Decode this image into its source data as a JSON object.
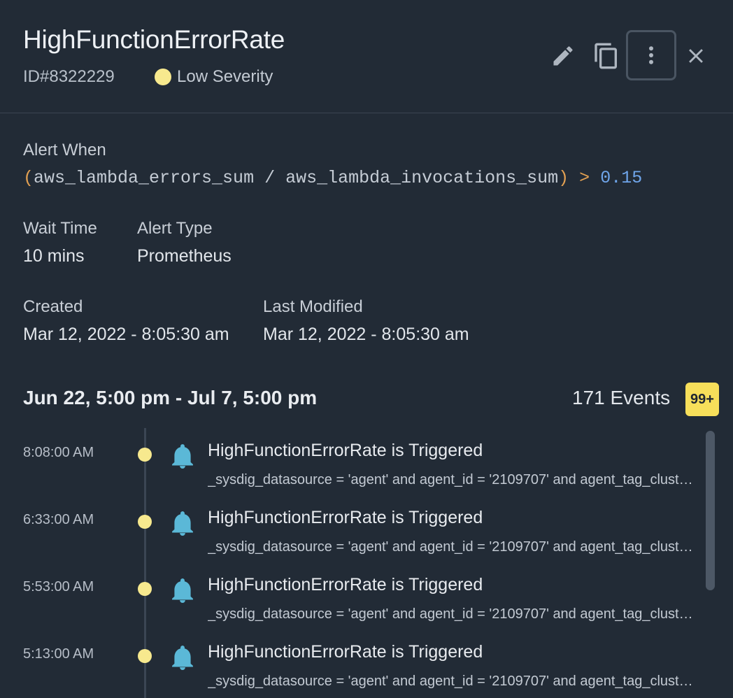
{
  "header": {
    "title": "HighFunctionErrorRate",
    "id_text": "ID#8322229",
    "severity": "Low Severity"
  },
  "icons": {
    "edit": "pencil-icon",
    "copy": "copy-icon",
    "more": "more-vertical-icon",
    "close": "close-icon",
    "event": "bell-icon"
  },
  "colors": {
    "background": "#222b36",
    "severity_low": "#f7e98e",
    "badge": "#f7df5a",
    "bell": "#5bb8d7",
    "operator": "#e2a052",
    "threshold": "#6fa5ea"
  },
  "alert": {
    "when_label": "Alert When",
    "query": {
      "open_paren": "(",
      "expr": "aws_lambda_errors_sum / aws_lambda_invocations_sum",
      "close_paren": ")",
      "operator": ">",
      "threshold": "0.15"
    },
    "wait_time_label": "Wait Time",
    "wait_time": "10 mins",
    "alert_type_label": "Alert Type",
    "alert_type": "Prometheus",
    "created_label": "Created",
    "created": "Mar 12, 2022 - 8:05:30 am",
    "modified_label": "Last Modified",
    "modified": "Mar 12, 2022 - 8:05:30 am"
  },
  "events": {
    "range": "Jun 22, 5:00 pm - Jul 7, 5:00 pm",
    "count": "171 Events",
    "badge": "99+",
    "items": [
      {
        "time": "8:08:00 AM",
        "title": "HighFunctionErrorRate is Triggered",
        "desc": "_sysdig_datasource = 'agent' and agent_id = '2109707' and agent_tag_cluster = 'prod'"
      },
      {
        "time": "6:33:00 AM",
        "title": "HighFunctionErrorRate is Triggered",
        "desc": "_sysdig_datasource = 'agent' and agent_id = '2109707' and agent_tag_cluster = 'prod'"
      },
      {
        "time": "5:53:00 AM",
        "title": "HighFunctionErrorRate is Triggered",
        "desc": "_sysdig_datasource = 'agent' and agent_id = '2109707' and agent_tag_cluster = 'prod'"
      },
      {
        "time": "5:13:00 AM",
        "title": "HighFunctionErrorRate is Triggered",
        "desc": "_sysdig_datasource = 'agent' and agent_id = '2109707' and agent_tag_cluster = 'prod'"
      }
    ]
  }
}
